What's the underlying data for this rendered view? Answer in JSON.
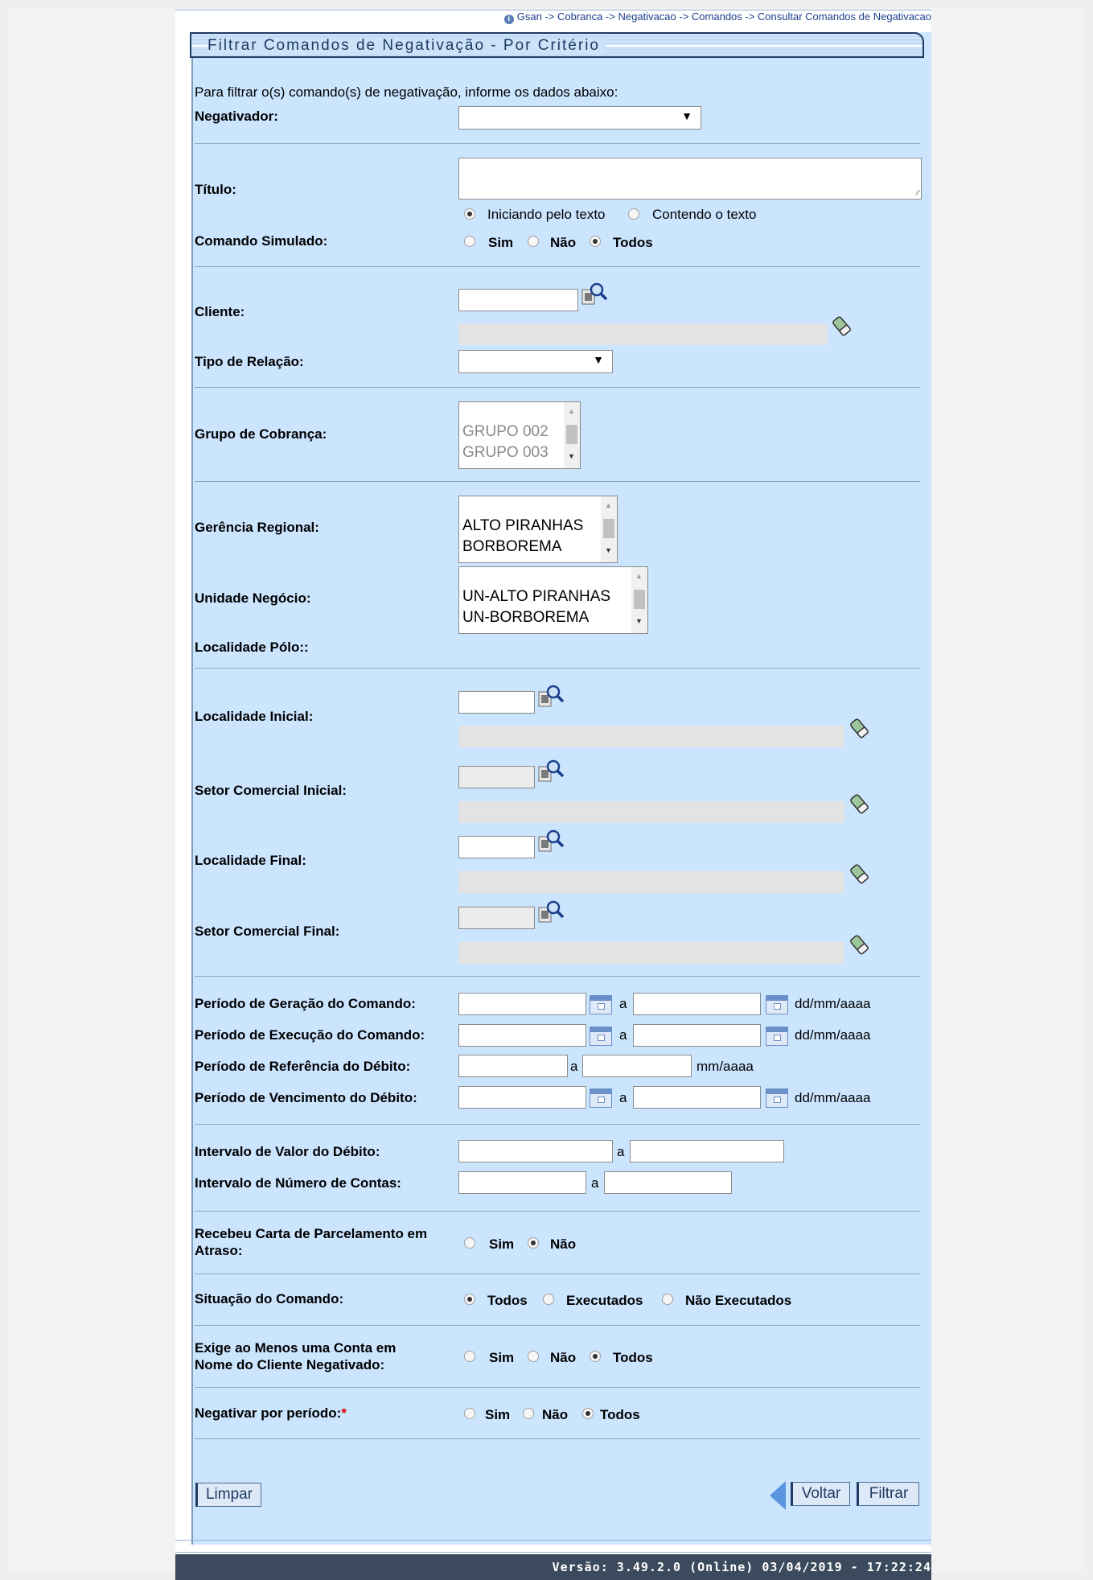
{
  "breadcrumb": "Gsan -> Cobranca -> Negativacao -> Comandos -> Consultar Comandos de Negativacao",
  "title": "Filtrar Comandos de Negativação - Por Critério",
  "intro": "Para filtrar o(s) comando(s) de negativação, informe os dados abaixo:",
  "labels": {
    "negativador": "Negativador:",
    "titulo": "Título:",
    "comando_simulado": "Comando Simulado:",
    "cliente": "Cliente:",
    "tipo_relacao": "Tipo de Relação:",
    "grupo_cobranca": "Grupo de Cobrança:",
    "gerencia_regional": "Gerência Regional:",
    "unidade_negocio": "Unidade Negócio:",
    "localidade_polo": "Localidade Pólo::",
    "localidade_inicial": "Localidade Inicial:",
    "setor_inicial": "Setor Comercial Inicial:",
    "localidade_final": "Localidade Final:",
    "setor_final": "Setor Comercial Final:",
    "periodo_geracao": "Período de Geração do Comando:",
    "periodo_execucao": "Período de Execução do Comando:",
    "periodo_referencia": "Período de Referência do Débito:",
    "periodo_vencimento": "Período de Vencimento do Débito:",
    "intervalo_valor": "Intervalo de Valor do Débito:",
    "intervalo_contas": "Intervalo de Número de Contas:",
    "carta_parcelamento_1": "Recebeu Carta de Parcelamento em",
    "carta_parcelamento_2": "Atraso:",
    "situacao_comando": "Situação do Comando:",
    "exige_conta_1": "Exige ao Menos uma Conta em",
    "exige_conta_2": "Nome do Cliente Negativado:",
    "negativar_periodo": "Negativar por período:",
    "required_mark": "*"
  },
  "titulo_options": {
    "iniciando": "Iniciando pelo texto",
    "contendo": "Contendo o texto",
    "selected": "iniciando"
  },
  "yes_no_all": {
    "sim": "Sim",
    "nao": "Não",
    "todos": "Todos"
  },
  "situacao_options": {
    "todos": "Todos",
    "executados": "Executados",
    "nao_executados": "Não Executados"
  },
  "grupo_cobranca_options": [
    "GRUPO 002",
    "GRUPO 003"
  ],
  "gerencia_regional_options": [
    "ALTO PIRANHAS",
    "BORBOREMA"
  ],
  "unidade_negocio_options": [
    "UN-ALTO PIRANHAS",
    "UN-BORBOREMA"
  ],
  "range_separator": "a",
  "date_format": "dd/mm/aaaa",
  "month_format": "mm/aaaa",
  "buttons": {
    "limpar": "Limpar",
    "voltar": "Voltar",
    "filtrar": "Filtrar"
  },
  "footer": "Versão: 3.49.2.0 (Online) 03/04/2019 - 17:22:24"
}
